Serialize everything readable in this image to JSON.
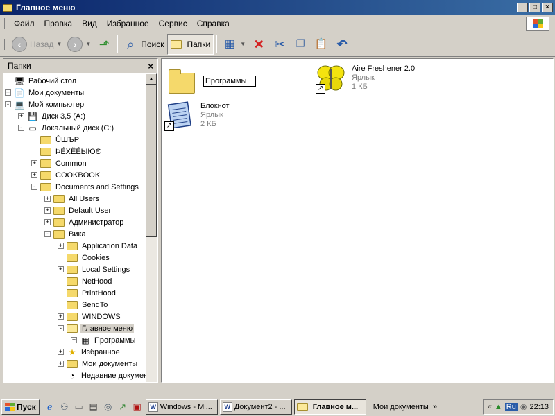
{
  "window": {
    "title": "Главное меню",
    "min": "_",
    "max": "□",
    "close": "×"
  },
  "menu": [
    "Файл",
    "Правка",
    "Вид",
    "Избранное",
    "Сервис",
    "Справка"
  ],
  "toolbar": {
    "back": "Назад",
    "search": "Поиск",
    "folders": "Папки"
  },
  "folders_panel": {
    "title": "Папки",
    "close": "×",
    "tree": [
      {
        "label": "Рабочий стол",
        "level": 0,
        "expander": "",
        "icon": "desktop-icon",
        "glyph": "🖥"
      },
      {
        "label": "Мои документы",
        "level": 0,
        "expander": "+",
        "icon": "my-documents-icon",
        "glyph": "📄"
      },
      {
        "label": "Мой компьютер",
        "level": 0,
        "expander": "-",
        "icon": "my-computer-icon",
        "glyph": "💻"
      },
      {
        "label": "Диск 3,5 (A:)",
        "level": 1,
        "expander": "+",
        "icon": "floppy-drive-icon",
        "glyph": "💾"
      },
      {
        "label": "Локальный диск (C:)",
        "level": 1,
        "expander": "-",
        "icon": "hard-drive-icon",
        "glyph": "▭"
      },
      {
        "label": "ÛШЪР",
        "level": 2,
        "expander": "",
        "icon": "folder-icon"
      },
      {
        "label": "ÞÉXËÉЫЮЄ",
        "level": 2,
        "expander": "",
        "icon": "folder-icon"
      },
      {
        "label": "Common",
        "level": 2,
        "expander": "+",
        "icon": "folder-icon"
      },
      {
        "label": "COOKBOOK",
        "level": 2,
        "expander": "+",
        "icon": "folder-icon"
      },
      {
        "label": "Documents and Settings",
        "level": 2,
        "expander": "-",
        "icon": "folder-icon"
      },
      {
        "label": "All Users",
        "level": 3,
        "expander": "+",
        "icon": "folder-icon"
      },
      {
        "label": "Default User",
        "level": 3,
        "expander": "+",
        "icon": "folder-icon"
      },
      {
        "label": "Администратор",
        "level": 3,
        "expander": "+",
        "icon": "folder-icon"
      },
      {
        "label": "Вика",
        "level": 3,
        "expander": "-",
        "icon": "folder-icon"
      },
      {
        "label": "Application Data",
        "level": 4,
        "expander": "+",
        "icon": "folder-icon"
      },
      {
        "label": "Cookies",
        "level": 4,
        "expander": "",
        "icon": "folder-icon"
      },
      {
        "label": "Local Settings",
        "level": 4,
        "expander": "+",
        "icon": "folder-icon"
      },
      {
        "label": "NetHood",
        "level": 4,
        "expander": "",
        "icon": "folder-icon"
      },
      {
        "label": "PrintHood",
        "level": 4,
        "expander": "",
        "icon": "folder-icon"
      },
      {
        "label": "SendTo",
        "level": 4,
        "expander": "",
        "icon": "folder-icon"
      },
      {
        "label": "WINDOWS",
        "level": 4,
        "expander": "+",
        "icon": "folder-icon"
      },
      {
        "label": "Главное меню",
        "level": 4,
        "expander": "-",
        "icon": "folder-open-icon",
        "selected": true
      },
      {
        "label": "Программы",
        "level": 5,
        "expander": "+",
        "icon": "programs-folder-icon",
        "glyph": "▦"
      },
      {
        "label": "Избранное",
        "level": 4,
        "expander": "+",
        "icon": "favorites-star-icon",
        "glyph": "★"
      },
      {
        "label": "Мои документы",
        "level": 4,
        "expander": "+",
        "icon": "folder-icon"
      },
      {
        "label": "Недавние документы",
        "level": 4,
        "expander": "",
        "icon": "recent-documents-icon",
        "glyph": "◔"
      }
    ]
  },
  "content": {
    "rename_value": "Программы",
    "items": [
      {
        "name": "Aire Freshener 2.0",
        "type": "Ярлык",
        "size": "1 КБ"
      },
      {
        "name": "Блокнот",
        "type": "Ярлык",
        "size": "2 КБ"
      }
    ]
  },
  "taskbar": {
    "start": "Пуск",
    "tasks": [
      {
        "label": "Windows - Mi...",
        "icon_letter": "W",
        "active": false
      },
      {
        "label": "Документ2 - ...",
        "icon_letter": "W",
        "active": false
      },
      {
        "label": "Главное м...",
        "icon_letter": "",
        "active": true
      }
    ],
    "toolbar_label": "Мои документы",
    "chevron": "»",
    "tray_chevron": "«",
    "language": "Ru",
    "clock": "22:13"
  },
  "colors": {
    "title_start": "#0a246a",
    "title_end": "#3a6ea5",
    "folder": "#f5d96b",
    "selection": "#d4d0c8"
  }
}
